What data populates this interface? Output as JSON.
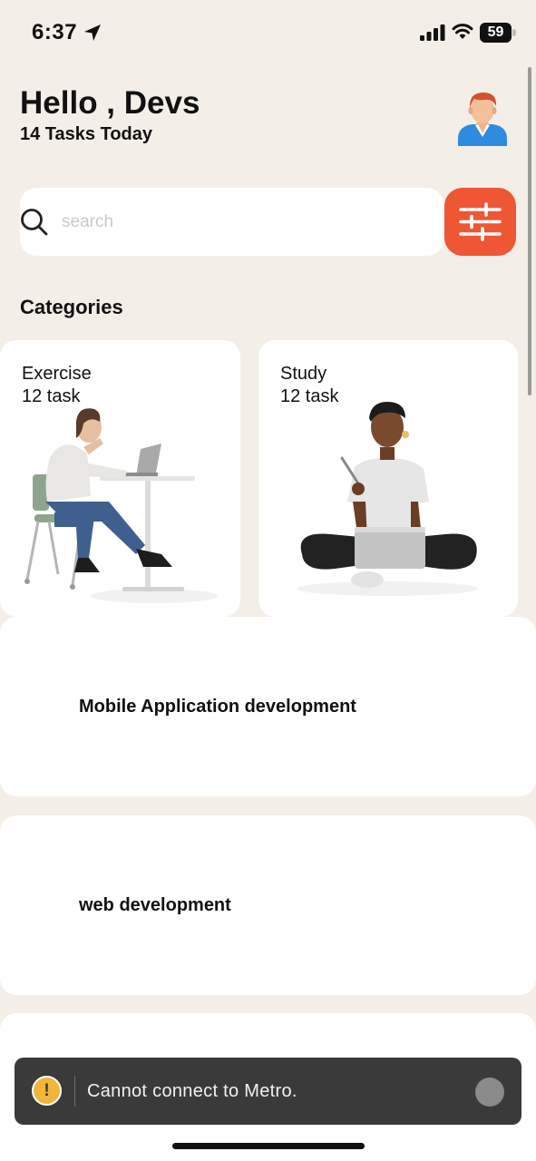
{
  "status_bar": {
    "time": "6:37",
    "battery": "59",
    "location_icon": "location-arrow-icon",
    "signal_icon": "cellular-signal-icon",
    "wifi_icon": "wifi-icon"
  },
  "header": {
    "greeting": "Hello , Devs",
    "subtitle": "14 Tasks Today",
    "avatar_icon": "user-avatar-icon"
  },
  "search": {
    "placeholder": "search",
    "value": "",
    "icon": "search-icon",
    "filter_icon": "sliders-icon"
  },
  "categories": {
    "title": "Categories",
    "items": [
      {
        "name": "Exercise",
        "count": "12 task"
      },
      {
        "name": "Study",
        "count": "12 task"
      }
    ]
  },
  "tasks": [
    {
      "title": "Mobile Application development"
    },
    {
      "title": "web development"
    },
    {
      "title": ""
    }
  ],
  "toast": {
    "message": "Cannot connect to Metro.",
    "icon": "warning-icon",
    "icon_glyph": "!"
  },
  "colors": {
    "background": "#F3EEE8",
    "accent": "#EF5633",
    "card": "#FFFFFF",
    "toast": "#3A3A3A",
    "warning": "#F2B53A"
  }
}
